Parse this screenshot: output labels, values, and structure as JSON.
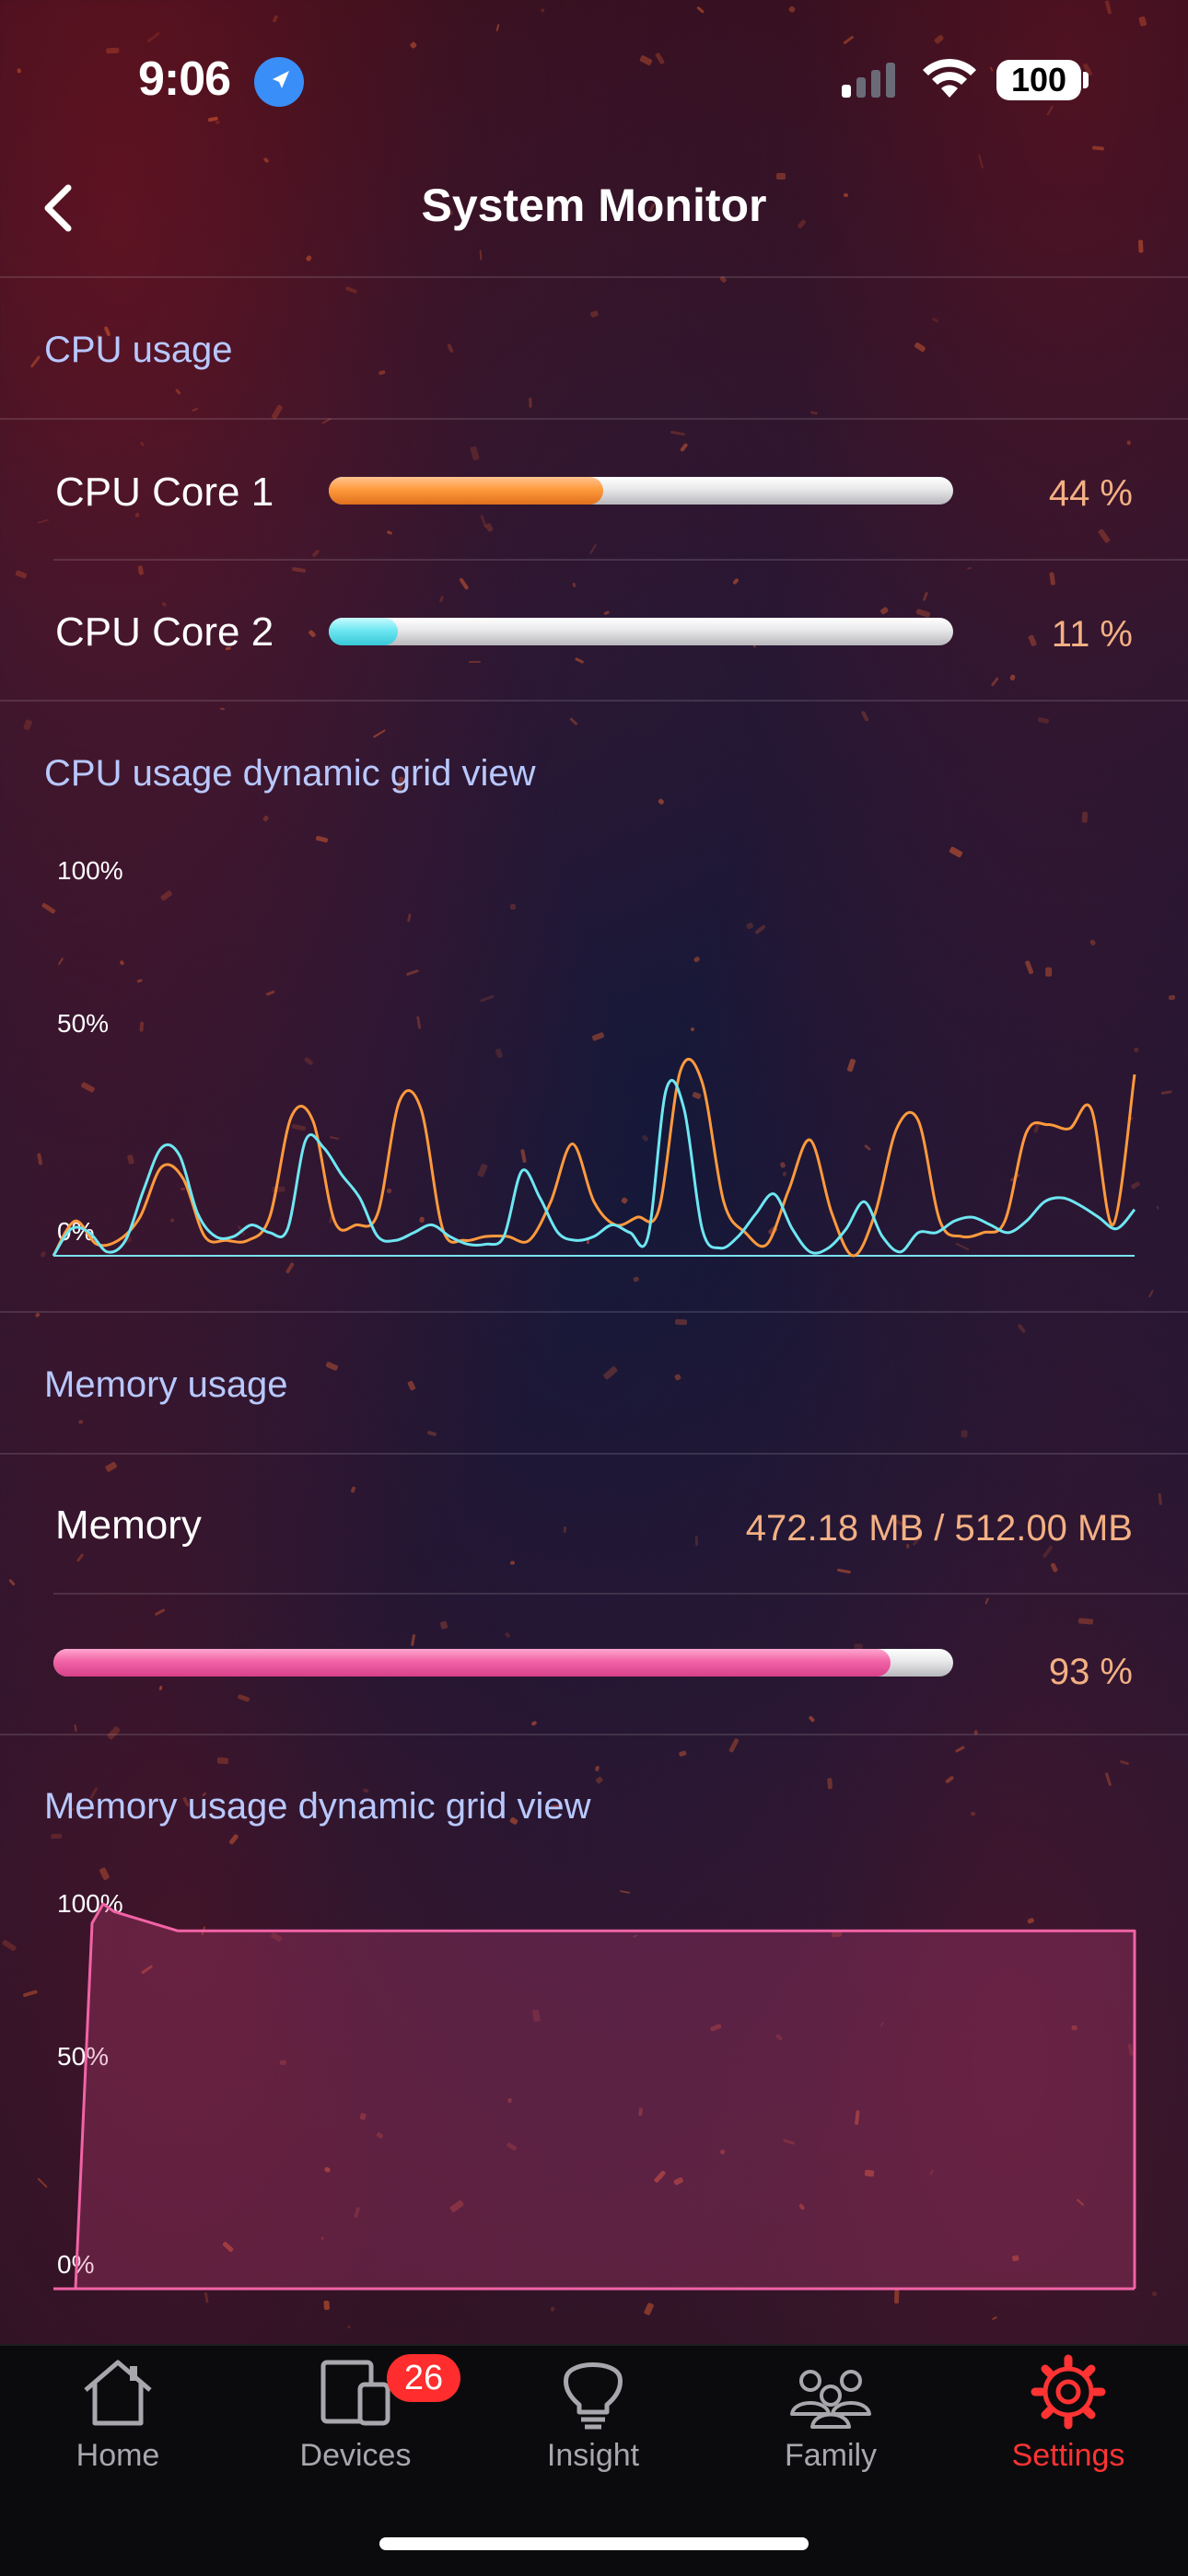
{
  "status_bar": {
    "time": "9:06",
    "battery": "100"
  },
  "nav": {
    "title": "System Monitor"
  },
  "cpu": {
    "section_label": "CPU usage",
    "cores": [
      {
        "label": "CPU Core 1",
        "percent_text": "44 %",
        "value": 0.44,
        "color": "#ff9a3d"
      },
      {
        "label": "CPU Core 2",
        "percent_text": "11 %",
        "value": 0.11,
        "color": "#6ee7f2"
      }
    ]
  },
  "cpu_chart": {
    "section_label": "CPU usage dynamic grid view",
    "y_labels": [
      "100%",
      "50%",
      "0%"
    ]
  },
  "memory": {
    "section_label": "Memory usage",
    "label": "Memory",
    "amount_text": "472.18 MB / 512.00 MB",
    "percent_text": "93 %",
    "value": 0.93,
    "color": "#f263a6"
  },
  "memory_chart": {
    "section_label": "Memory usage dynamic grid view",
    "y_labels": [
      "100%",
      "50%",
      "0%"
    ]
  },
  "chart_data": [
    {
      "type": "line",
      "ylim": [
        0,
        100
      ],
      "series": [
        {
          "color": "#ff9a3d",
          "values": [
            0,
            9,
            3,
            4,
            10,
            23,
            20,
            5,
            4,
            4,
            10,
            36,
            35,
            9,
            8,
            11,
            40,
            38,
            7,
            4,
            5,
            5,
            4,
            14,
            29,
            14,
            8,
            10,
            12,
            48,
            45,
            14,
            6,
            3,
            17,
            30,
            11,
            0,
            11,
            33,
            35,
            9,
            5,
            6,
            9,
            32,
            34,
            33,
            38,
            8,
            47
          ]
        },
        {
          "color": "#6ee7f2",
          "values": [
            0,
            7,
            6,
            1,
            4,
            17,
            28,
            26,
            11,
            5,
            5,
            8,
            6,
            7,
            30,
            28,
            21,
            15,
            5,
            4,
            6,
            8,
            5,
            3,
            3,
            5,
            22,
            15,
            6,
            4,
            5,
            8,
            6,
            5,
            43,
            38,
            7,
            2,
            5,
            11,
            16,
            7,
            1,
            2,
            7,
            14,
            5,
            1,
            6,
            6,
            9,
            10,
            8,
            6,
            9,
            14,
            15,
            13,
            10,
            7,
            12
          ]
        }
      ]
    },
    {
      "type": "area",
      "ylim": [
        0,
        100
      ],
      "series": [
        {
          "color": "#f263a6",
          "values": [
            0,
            95,
            100,
            98,
            93,
            93,
            93,
            93,
            93,
            93,
            93,
            93,
            93,
            93,
            93,
            93,
            93,
            93,
            93,
            93
          ]
        }
      ]
    }
  ],
  "tabs": [
    {
      "label": "Home",
      "icon": "home-icon"
    },
    {
      "label": "Devices",
      "icon": "devices-icon",
      "badge": "26"
    },
    {
      "label": "Insight",
      "icon": "lightbulb-icon"
    },
    {
      "label": "Family",
      "icon": "family-icon"
    },
    {
      "label": "Settings",
      "icon": "gear-icon",
      "active": true
    }
  ]
}
